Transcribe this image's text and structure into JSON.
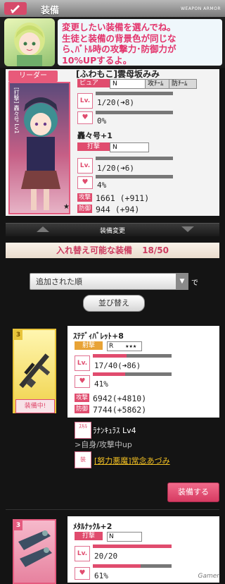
{
  "header": {
    "title": "装備",
    "subtitle": "WEAPON ARMOR"
  },
  "speech": {
    "text_line1": "変更したい装備を選んでね。",
    "text_line2": "生徒と装備の背景色が同じな",
    "text_line3": "ら､ﾊﾞﾄﾙ時の攻撃力･防御力が",
    "text_line4": "10%UPするよ。"
  },
  "leader": {
    "tag": "リーダー",
    "card_label": "[打撃] 轟々号 Lv1",
    "name": "[ふわもこ]雲母坂みみ",
    "type_badge": "ピュア",
    "rank": "N",
    "attack_team": "攻ﾁｰﾑ",
    "defense_team": "防ﾁｰﾑ",
    "lv_label": "Lv.",
    "lv": "1/20(➜8)",
    "affection": "0%",
    "weapon_name": "轟々号+1",
    "weapon_type": "打撃",
    "weapon_rank": "N",
    "weapon_lv": "1/20(➜6)",
    "weapon_affection": "4%",
    "attack_label": "攻撃",
    "attack": "1661 (+911)",
    "defense_label": "防御",
    "defense": "944 (+94)"
  },
  "tabbar": {
    "label": "装備変更"
  },
  "section": {
    "title": "入れ替え可能な装備",
    "count": "18/50"
  },
  "sort": {
    "selected": "追加された順",
    "suffix": "で",
    "button": "並び替え"
  },
  "items": [
    {
      "rarity": "3",
      "name": "ｽﾃﾃﾞｨﾊﾞﾚｯﾄ+8",
      "type": "射撃",
      "rank": "R",
      "stars": "★★★",
      "lv": "17/40(➜86)",
      "lv_progress": 0.425,
      "affection": "41%",
      "affection_progress": 0.41,
      "attack": "6942(+4810)",
      "defense": "7744(+5862)",
      "skill_label": "ｽｷﾙ",
      "skill_name": "ﾗﾅﾝｷｭﾗｽ Lv4",
      "skill_desc": ">自身/攻撃中up",
      "equip_label": "装",
      "equipped_by": "[努力悪魔]常念あづみ",
      "status": "装備中!",
      "button": "装備する"
    },
    {
      "rarity": "3",
      "name": "ﾒﾀﾙﾅｯｸﾙ+2",
      "type": "打撃",
      "rank": "N",
      "lv": "20/20",
      "lv_progress": 1.0,
      "affection": "61%",
      "affection_progress": 0.61
    }
  ],
  "watermark": "Gamer"
}
